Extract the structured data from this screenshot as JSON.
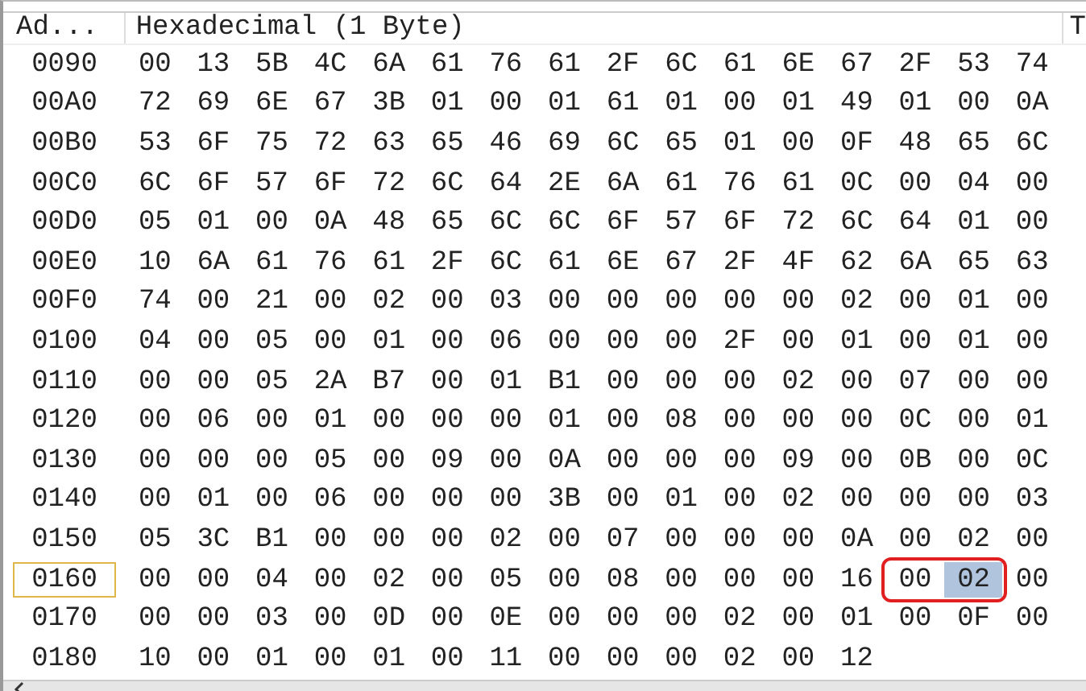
{
  "columns": {
    "address": "Ad...",
    "hex": "Hexadecimal (1 Byte)",
    "text": "T"
  },
  "rows": [
    {
      "address": "0090",
      "selected": false,
      "bytes": [
        {
          "value": "00",
          "selected": false,
          "boxed": false
        },
        {
          "value": "13",
          "selected": false,
          "boxed": false
        },
        {
          "value": "5B",
          "selected": false,
          "boxed": false
        },
        {
          "value": "4C",
          "selected": false,
          "boxed": false
        },
        {
          "value": "6A",
          "selected": false,
          "boxed": false
        },
        {
          "value": "61",
          "selected": false,
          "boxed": false
        },
        {
          "value": "76",
          "selected": false,
          "boxed": false
        },
        {
          "value": "61",
          "selected": false,
          "boxed": false
        },
        {
          "value": "2F",
          "selected": false,
          "boxed": false
        },
        {
          "value": "6C",
          "selected": false,
          "boxed": false
        },
        {
          "value": "61",
          "selected": false,
          "boxed": false
        },
        {
          "value": "6E",
          "selected": false,
          "boxed": false
        },
        {
          "value": "67",
          "selected": false,
          "boxed": false
        },
        {
          "value": "2F",
          "selected": false,
          "boxed": false
        },
        {
          "value": "53",
          "selected": false,
          "boxed": false
        },
        {
          "value": "74",
          "selected": false,
          "boxed": false
        }
      ]
    },
    {
      "address": "00A0",
      "selected": false,
      "bytes": [
        {
          "value": "72",
          "selected": false,
          "boxed": false
        },
        {
          "value": "69",
          "selected": false,
          "boxed": false
        },
        {
          "value": "6E",
          "selected": false,
          "boxed": false
        },
        {
          "value": "67",
          "selected": false,
          "boxed": false
        },
        {
          "value": "3B",
          "selected": false,
          "boxed": false
        },
        {
          "value": "01",
          "selected": false,
          "boxed": false
        },
        {
          "value": "00",
          "selected": false,
          "boxed": false
        },
        {
          "value": "01",
          "selected": false,
          "boxed": false
        },
        {
          "value": "61",
          "selected": false,
          "boxed": false
        },
        {
          "value": "01",
          "selected": false,
          "boxed": false
        },
        {
          "value": "00",
          "selected": false,
          "boxed": false
        },
        {
          "value": "01",
          "selected": false,
          "boxed": false
        },
        {
          "value": "49",
          "selected": false,
          "boxed": false
        },
        {
          "value": "01",
          "selected": false,
          "boxed": false
        },
        {
          "value": "00",
          "selected": false,
          "boxed": false
        },
        {
          "value": "0A",
          "selected": false,
          "boxed": false
        }
      ]
    },
    {
      "address": "00B0",
      "selected": false,
      "bytes": [
        {
          "value": "53",
          "selected": false,
          "boxed": false
        },
        {
          "value": "6F",
          "selected": false,
          "boxed": false
        },
        {
          "value": "75",
          "selected": false,
          "boxed": false
        },
        {
          "value": "72",
          "selected": false,
          "boxed": false
        },
        {
          "value": "63",
          "selected": false,
          "boxed": false
        },
        {
          "value": "65",
          "selected": false,
          "boxed": false
        },
        {
          "value": "46",
          "selected": false,
          "boxed": false
        },
        {
          "value": "69",
          "selected": false,
          "boxed": false
        },
        {
          "value": "6C",
          "selected": false,
          "boxed": false
        },
        {
          "value": "65",
          "selected": false,
          "boxed": false
        },
        {
          "value": "01",
          "selected": false,
          "boxed": false
        },
        {
          "value": "00",
          "selected": false,
          "boxed": false
        },
        {
          "value": "0F",
          "selected": false,
          "boxed": false
        },
        {
          "value": "48",
          "selected": false,
          "boxed": false
        },
        {
          "value": "65",
          "selected": false,
          "boxed": false
        },
        {
          "value": "6C",
          "selected": false,
          "boxed": false
        }
      ]
    },
    {
      "address": "00C0",
      "selected": false,
      "bytes": [
        {
          "value": "6C",
          "selected": false,
          "boxed": false
        },
        {
          "value": "6F",
          "selected": false,
          "boxed": false
        },
        {
          "value": "57",
          "selected": false,
          "boxed": false
        },
        {
          "value": "6F",
          "selected": false,
          "boxed": false
        },
        {
          "value": "72",
          "selected": false,
          "boxed": false
        },
        {
          "value": "6C",
          "selected": false,
          "boxed": false
        },
        {
          "value": "64",
          "selected": false,
          "boxed": false
        },
        {
          "value": "2E",
          "selected": false,
          "boxed": false
        },
        {
          "value": "6A",
          "selected": false,
          "boxed": false
        },
        {
          "value": "61",
          "selected": false,
          "boxed": false
        },
        {
          "value": "76",
          "selected": false,
          "boxed": false
        },
        {
          "value": "61",
          "selected": false,
          "boxed": false
        },
        {
          "value": "0C",
          "selected": false,
          "boxed": false
        },
        {
          "value": "00",
          "selected": false,
          "boxed": false
        },
        {
          "value": "04",
          "selected": false,
          "boxed": false
        },
        {
          "value": "00",
          "selected": false,
          "boxed": false
        }
      ]
    },
    {
      "address": "00D0",
      "selected": false,
      "bytes": [
        {
          "value": "05",
          "selected": false,
          "boxed": false
        },
        {
          "value": "01",
          "selected": false,
          "boxed": false
        },
        {
          "value": "00",
          "selected": false,
          "boxed": false
        },
        {
          "value": "0A",
          "selected": false,
          "boxed": false
        },
        {
          "value": "48",
          "selected": false,
          "boxed": false
        },
        {
          "value": "65",
          "selected": false,
          "boxed": false
        },
        {
          "value": "6C",
          "selected": false,
          "boxed": false
        },
        {
          "value": "6C",
          "selected": false,
          "boxed": false
        },
        {
          "value": "6F",
          "selected": false,
          "boxed": false
        },
        {
          "value": "57",
          "selected": false,
          "boxed": false
        },
        {
          "value": "6F",
          "selected": false,
          "boxed": false
        },
        {
          "value": "72",
          "selected": false,
          "boxed": false
        },
        {
          "value": "6C",
          "selected": false,
          "boxed": false
        },
        {
          "value": "64",
          "selected": false,
          "boxed": false
        },
        {
          "value": "01",
          "selected": false,
          "boxed": false
        },
        {
          "value": "00",
          "selected": false,
          "boxed": false
        }
      ]
    },
    {
      "address": "00E0",
      "selected": false,
      "bytes": [
        {
          "value": "10",
          "selected": false,
          "boxed": false
        },
        {
          "value": "6A",
          "selected": false,
          "boxed": false
        },
        {
          "value": "61",
          "selected": false,
          "boxed": false
        },
        {
          "value": "76",
          "selected": false,
          "boxed": false
        },
        {
          "value": "61",
          "selected": false,
          "boxed": false
        },
        {
          "value": "2F",
          "selected": false,
          "boxed": false
        },
        {
          "value": "6C",
          "selected": false,
          "boxed": false
        },
        {
          "value": "61",
          "selected": false,
          "boxed": false
        },
        {
          "value": "6E",
          "selected": false,
          "boxed": false
        },
        {
          "value": "67",
          "selected": false,
          "boxed": false
        },
        {
          "value": "2F",
          "selected": false,
          "boxed": false
        },
        {
          "value": "4F",
          "selected": false,
          "boxed": false
        },
        {
          "value": "62",
          "selected": false,
          "boxed": false
        },
        {
          "value": "6A",
          "selected": false,
          "boxed": false
        },
        {
          "value": "65",
          "selected": false,
          "boxed": false
        },
        {
          "value": "63",
          "selected": false,
          "boxed": false
        }
      ]
    },
    {
      "address": "00F0",
      "selected": false,
      "bytes": [
        {
          "value": "74",
          "selected": false,
          "boxed": false
        },
        {
          "value": "00",
          "selected": false,
          "boxed": false
        },
        {
          "value": "21",
          "selected": false,
          "boxed": false
        },
        {
          "value": "00",
          "selected": false,
          "boxed": false
        },
        {
          "value": "02",
          "selected": false,
          "boxed": false
        },
        {
          "value": "00",
          "selected": false,
          "boxed": false
        },
        {
          "value": "03",
          "selected": false,
          "boxed": false
        },
        {
          "value": "00",
          "selected": false,
          "boxed": false
        },
        {
          "value": "00",
          "selected": false,
          "boxed": false
        },
        {
          "value": "00",
          "selected": false,
          "boxed": false
        },
        {
          "value": "00",
          "selected": false,
          "boxed": false
        },
        {
          "value": "00",
          "selected": false,
          "boxed": false
        },
        {
          "value": "02",
          "selected": false,
          "boxed": false
        },
        {
          "value": "00",
          "selected": false,
          "boxed": false
        },
        {
          "value": "01",
          "selected": false,
          "boxed": false
        },
        {
          "value": "00",
          "selected": false,
          "boxed": false
        }
      ]
    },
    {
      "address": "0100",
      "selected": false,
      "bytes": [
        {
          "value": "04",
          "selected": false,
          "boxed": false
        },
        {
          "value": "00",
          "selected": false,
          "boxed": false
        },
        {
          "value": "05",
          "selected": false,
          "boxed": false
        },
        {
          "value": "00",
          "selected": false,
          "boxed": false
        },
        {
          "value": "01",
          "selected": false,
          "boxed": false
        },
        {
          "value": "00",
          "selected": false,
          "boxed": false
        },
        {
          "value": "06",
          "selected": false,
          "boxed": false
        },
        {
          "value": "00",
          "selected": false,
          "boxed": false
        },
        {
          "value": "00",
          "selected": false,
          "boxed": false
        },
        {
          "value": "00",
          "selected": false,
          "boxed": false
        },
        {
          "value": "2F",
          "selected": false,
          "boxed": false
        },
        {
          "value": "00",
          "selected": false,
          "boxed": false
        },
        {
          "value": "01",
          "selected": false,
          "boxed": false
        },
        {
          "value": "00",
          "selected": false,
          "boxed": false
        },
        {
          "value": "01",
          "selected": false,
          "boxed": false
        },
        {
          "value": "00",
          "selected": false,
          "boxed": false
        }
      ]
    },
    {
      "address": "0110",
      "selected": false,
      "bytes": [
        {
          "value": "00",
          "selected": false,
          "boxed": false
        },
        {
          "value": "00",
          "selected": false,
          "boxed": false
        },
        {
          "value": "05",
          "selected": false,
          "boxed": false
        },
        {
          "value": "2A",
          "selected": false,
          "boxed": false
        },
        {
          "value": "B7",
          "selected": false,
          "boxed": false
        },
        {
          "value": "00",
          "selected": false,
          "boxed": false
        },
        {
          "value": "01",
          "selected": false,
          "boxed": false
        },
        {
          "value": "B1",
          "selected": false,
          "boxed": false
        },
        {
          "value": "00",
          "selected": false,
          "boxed": false
        },
        {
          "value": "00",
          "selected": false,
          "boxed": false
        },
        {
          "value": "00",
          "selected": false,
          "boxed": false
        },
        {
          "value": "02",
          "selected": false,
          "boxed": false
        },
        {
          "value": "00",
          "selected": false,
          "boxed": false
        },
        {
          "value": "07",
          "selected": false,
          "boxed": false
        },
        {
          "value": "00",
          "selected": false,
          "boxed": false
        },
        {
          "value": "00",
          "selected": false,
          "boxed": false
        }
      ]
    },
    {
      "address": "0120",
      "selected": false,
      "bytes": [
        {
          "value": "00",
          "selected": false,
          "boxed": false
        },
        {
          "value": "06",
          "selected": false,
          "boxed": false
        },
        {
          "value": "00",
          "selected": false,
          "boxed": false
        },
        {
          "value": "01",
          "selected": false,
          "boxed": false
        },
        {
          "value": "00",
          "selected": false,
          "boxed": false
        },
        {
          "value": "00",
          "selected": false,
          "boxed": false
        },
        {
          "value": "00",
          "selected": false,
          "boxed": false
        },
        {
          "value": "01",
          "selected": false,
          "boxed": false
        },
        {
          "value": "00",
          "selected": false,
          "boxed": false
        },
        {
          "value": "08",
          "selected": false,
          "boxed": false
        },
        {
          "value": "00",
          "selected": false,
          "boxed": false
        },
        {
          "value": "00",
          "selected": false,
          "boxed": false
        },
        {
          "value": "00",
          "selected": false,
          "boxed": false
        },
        {
          "value": "0C",
          "selected": false,
          "boxed": false
        },
        {
          "value": "00",
          "selected": false,
          "boxed": false
        },
        {
          "value": "01",
          "selected": false,
          "boxed": false
        }
      ]
    },
    {
      "address": "0130",
      "selected": false,
      "bytes": [
        {
          "value": "00",
          "selected": false,
          "boxed": false
        },
        {
          "value": "00",
          "selected": false,
          "boxed": false
        },
        {
          "value": "00",
          "selected": false,
          "boxed": false
        },
        {
          "value": "05",
          "selected": false,
          "boxed": false
        },
        {
          "value": "00",
          "selected": false,
          "boxed": false
        },
        {
          "value": "09",
          "selected": false,
          "boxed": false
        },
        {
          "value": "00",
          "selected": false,
          "boxed": false
        },
        {
          "value": "0A",
          "selected": false,
          "boxed": false
        },
        {
          "value": "00",
          "selected": false,
          "boxed": false
        },
        {
          "value": "00",
          "selected": false,
          "boxed": false
        },
        {
          "value": "00",
          "selected": false,
          "boxed": false
        },
        {
          "value": "09",
          "selected": false,
          "boxed": false
        },
        {
          "value": "00",
          "selected": false,
          "boxed": false
        },
        {
          "value": "0B",
          "selected": false,
          "boxed": false
        },
        {
          "value": "00",
          "selected": false,
          "boxed": false
        },
        {
          "value": "0C",
          "selected": false,
          "boxed": false
        }
      ]
    },
    {
      "address": "0140",
      "selected": false,
      "bytes": [
        {
          "value": "00",
          "selected": false,
          "boxed": false
        },
        {
          "value": "01",
          "selected": false,
          "boxed": false
        },
        {
          "value": "00",
          "selected": false,
          "boxed": false
        },
        {
          "value": "06",
          "selected": false,
          "boxed": false
        },
        {
          "value": "00",
          "selected": false,
          "boxed": false
        },
        {
          "value": "00",
          "selected": false,
          "boxed": false
        },
        {
          "value": "00",
          "selected": false,
          "boxed": false
        },
        {
          "value": "3B",
          "selected": false,
          "boxed": false
        },
        {
          "value": "00",
          "selected": false,
          "boxed": false
        },
        {
          "value": "01",
          "selected": false,
          "boxed": false
        },
        {
          "value": "00",
          "selected": false,
          "boxed": false
        },
        {
          "value": "02",
          "selected": false,
          "boxed": false
        },
        {
          "value": "00",
          "selected": false,
          "boxed": false
        },
        {
          "value": "00",
          "selected": false,
          "boxed": false
        },
        {
          "value": "00",
          "selected": false,
          "boxed": false
        },
        {
          "value": "03",
          "selected": false,
          "boxed": false
        }
      ]
    },
    {
      "address": "0150",
      "selected": false,
      "bytes": [
        {
          "value": "05",
          "selected": false,
          "boxed": false
        },
        {
          "value": "3C",
          "selected": false,
          "boxed": false
        },
        {
          "value": "B1",
          "selected": false,
          "boxed": false
        },
        {
          "value": "00",
          "selected": false,
          "boxed": false
        },
        {
          "value": "00",
          "selected": false,
          "boxed": false
        },
        {
          "value": "00",
          "selected": false,
          "boxed": false
        },
        {
          "value": "02",
          "selected": false,
          "boxed": false
        },
        {
          "value": "00",
          "selected": false,
          "boxed": false
        },
        {
          "value": "07",
          "selected": false,
          "boxed": false
        },
        {
          "value": "00",
          "selected": false,
          "boxed": false
        },
        {
          "value": "00",
          "selected": false,
          "boxed": false
        },
        {
          "value": "00",
          "selected": false,
          "boxed": false
        },
        {
          "value": "0A",
          "selected": false,
          "boxed": false
        },
        {
          "value": "00",
          "selected": false,
          "boxed": false
        },
        {
          "value": "02",
          "selected": false,
          "boxed": false
        },
        {
          "value": "00",
          "selected": false,
          "boxed": false
        }
      ]
    },
    {
      "address": "0160",
      "selected": true,
      "bytes": [
        {
          "value": "00",
          "selected": false,
          "boxed": false
        },
        {
          "value": "00",
          "selected": false,
          "boxed": false
        },
        {
          "value": "04",
          "selected": false,
          "boxed": false
        },
        {
          "value": "00",
          "selected": false,
          "boxed": false
        },
        {
          "value": "02",
          "selected": false,
          "boxed": false
        },
        {
          "value": "00",
          "selected": false,
          "boxed": false
        },
        {
          "value": "05",
          "selected": false,
          "boxed": false
        },
        {
          "value": "00",
          "selected": false,
          "boxed": false
        },
        {
          "value": "08",
          "selected": false,
          "boxed": false
        },
        {
          "value": "00",
          "selected": false,
          "boxed": false
        },
        {
          "value": "00",
          "selected": false,
          "boxed": false
        },
        {
          "value": "00",
          "selected": false,
          "boxed": false
        },
        {
          "value": "16",
          "selected": false,
          "boxed": false
        },
        {
          "value": "00",
          "selected": false,
          "boxed": true
        },
        {
          "value": "02",
          "selected": true,
          "boxed": true
        },
        {
          "value": "00",
          "selected": false,
          "boxed": false
        }
      ]
    },
    {
      "address": "0170",
      "selected": false,
      "bytes": [
        {
          "value": "00",
          "selected": false,
          "boxed": false
        },
        {
          "value": "00",
          "selected": false,
          "boxed": false
        },
        {
          "value": "03",
          "selected": false,
          "boxed": false
        },
        {
          "value": "00",
          "selected": false,
          "boxed": false
        },
        {
          "value": "0D",
          "selected": false,
          "boxed": false
        },
        {
          "value": "00",
          "selected": false,
          "boxed": false
        },
        {
          "value": "0E",
          "selected": false,
          "boxed": false
        },
        {
          "value": "00",
          "selected": false,
          "boxed": false
        },
        {
          "value": "00",
          "selected": false,
          "boxed": false
        },
        {
          "value": "00",
          "selected": false,
          "boxed": false
        },
        {
          "value": "02",
          "selected": false,
          "boxed": false
        },
        {
          "value": "00",
          "selected": false,
          "boxed": false
        },
        {
          "value": "01",
          "selected": false,
          "boxed": false
        },
        {
          "value": "00",
          "selected": false,
          "boxed": false
        },
        {
          "value": "0F",
          "selected": false,
          "boxed": false
        },
        {
          "value": "00",
          "selected": false,
          "boxed": false
        }
      ]
    },
    {
      "address": "0180",
      "selected": false,
      "bytes": [
        {
          "value": "10",
          "selected": false,
          "boxed": false
        },
        {
          "value": "00",
          "selected": false,
          "boxed": false
        },
        {
          "value": "01",
          "selected": false,
          "boxed": false
        },
        {
          "value": "00",
          "selected": false,
          "boxed": false
        },
        {
          "value": "01",
          "selected": false,
          "boxed": false
        },
        {
          "value": "00",
          "selected": false,
          "boxed": false
        },
        {
          "value": "11",
          "selected": false,
          "boxed": false
        },
        {
          "value": "00",
          "selected": false,
          "boxed": false
        },
        {
          "value": "00",
          "selected": false,
          "boxed": false
        },
        {
          "value": "00",
          "selected": false,
          "boxed": false
        },
        {
          "value": "02",
          "selected": false,
          "boxed": false
        },
        {
          "value": "00",
          "selected": false,
          "boxed": false
        },
        {
          "value": "12",
          "selected": false,
          "boxed": false
        }
      ]
    }
  ]
}
